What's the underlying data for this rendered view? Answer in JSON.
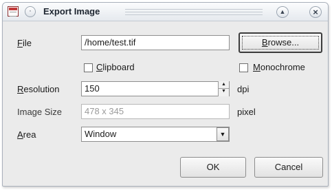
{
  "window": {
    "title": "Export Image",
    "app_icon": "image-export-icon",
    "menu_icon": "circle-dot-icon",
    "shade_icon": "chevron-up-icon",
    "close_icon": "close-icon"
  },
  "file": {
    "label_mnemonic": "F",
    "label_rest": "ile",
    "value": "/home/test.tif",
    "browse_mnemonic": "B",
    "browse_rest": "rowse..."
  },
  "clipboard": {
    "mnemonic": "C",
    "rest": "lipboard",
    "checked": false
  },
  "monochrome": {
    "mnemonic": "M",
    "rest": "onochrome",
    "checked": false
  },
  "resolution": {
    "label_mnemonic": "R",
    "label_rest": "esolution",
    "value": "150",
    "unit": "dpi"
  },
  "image_size": {
    "label": "Image Size",
    "value": "478 x 345",
    "unit": "pixel"
  },
  "area": {
    "label_mnemonic": "A",
    "label_rest": "rea",
    "value": "Window"
  },
  "buttons": {
    "ok": "OK",
    "cancel": "Cancel"
  }
}
